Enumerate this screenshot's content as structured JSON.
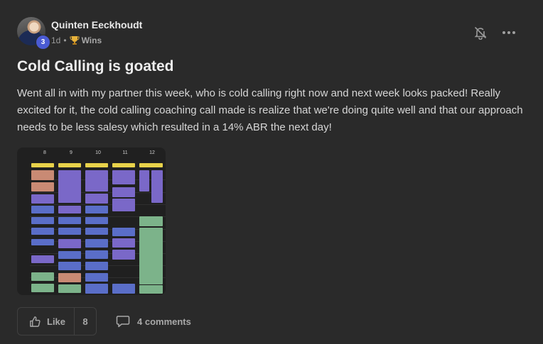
{
  "post": {
    "author": {
      "name": "Quinten Eeckhoudt",
      "level": "3"
    },
    "meta": {
      "time": "1d",
      "separator": "•",
      "category": "Wins",
      "category_icon": "trophy-icon"
    },
    "title": "Cold Calling is goated",
    "body": "Went all in with my partner this week, who is cold calling right now and next week looks packed! Really excited for it, the cold calling coaching call made is realize that we're doing quite well and that our approach needs to be less salesy which resulted in a 14% ABR the next day!",
    "calendar_thumbnail": {
      "days": [
        "8",
        "9",
        "10",
        "11",
        "12"
      ]
    },
    "actions": {
      "like_label": "Like",
      "like_count": "8",
      "comments_label": "4 comments"
    },
    "icons": {
      "notify": "bell-off-icon",
      "menu": "more-horizontal-icon",
      "like": "thumbs-up-icon",
      "comment": "comment-icon"
    }
  },
  "colors": {
    "background": "#2a2a2a",
    "level_badge": "#4a5bd4",
    "event_purple": "#7a68c8",
    "event_green": "#7cb38a",
    "event_orange": "#c98a74",
    "event_yellow": "#e8d24a"
  }
}
